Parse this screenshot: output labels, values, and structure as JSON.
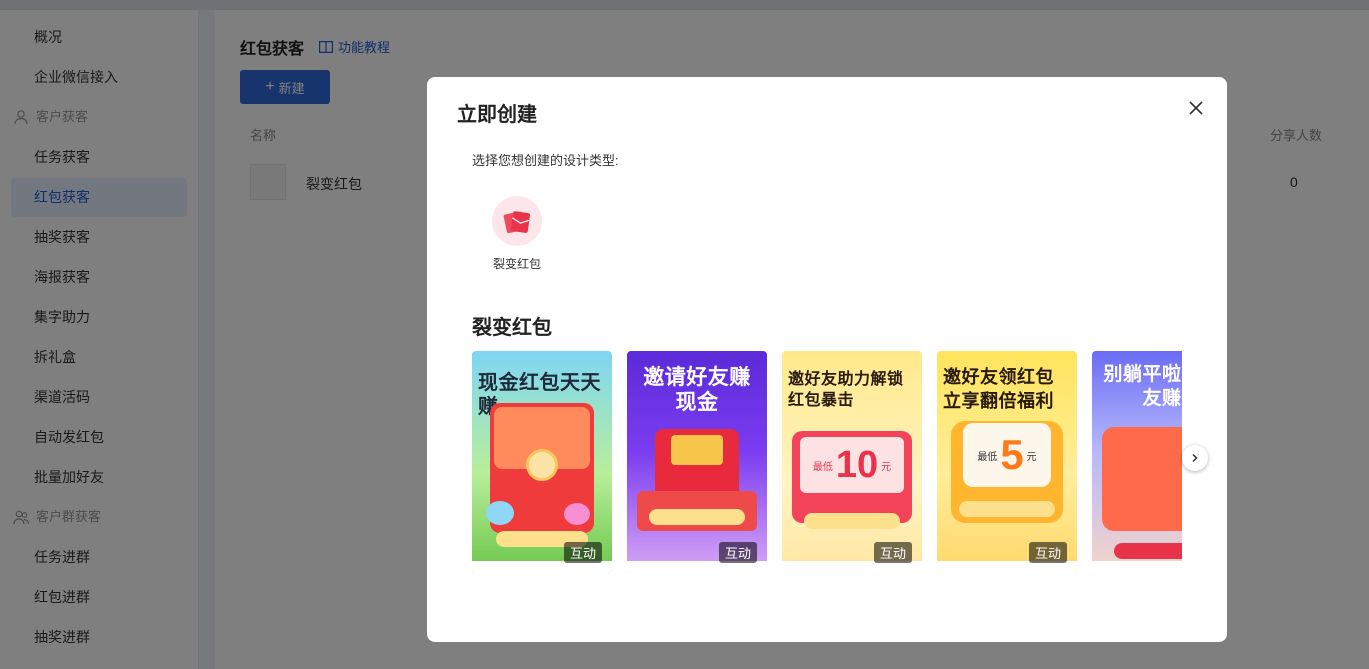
{
  "sidebar": {
    "items": [
      {
        "label": "概况"
      },
      {
        "label": "企业微信接入"
      },
      {
        "label": "客户获客",
        "group": true
      },
      {
        "label": "任务获客"
      },
      {
        "label": "红包获客",
        "active": true
      },
      {
        "label": "抽奖获客"
      },
      {
        "label": "海报获客"
      },
      {
        "label": "集字助力"
      },
      {
        "label": "拆礼盒"
      },
      {
        "label": "渠道活码"
      },
      {
        "label": "自动发红包"
      },
      {
        "label": "批量加好友"
      },
      {
        "label": "客户群获客",
        "group": true
      },
      {
        "label": "任务进群"
      },
      {
        "label": "红包进群"
      },
      {
        "label": "抽奖进群"
      }
    ]
  },
  "page": {
    "title": "红包获客",
    "tutorial_label": "功能教程",
    "new_button": "新建",
    "table": {
      "columns": {
        "name": "名称",
        "share_count": "分享人数"
      },
      "rows": [
        {
          "name": "裂变红包",
          "share_count": "0"
        }
      ]
    }
  },
  "modal": {
    "title": "立即创建",
    "prompt": "选择您想创建的设计类型:",
    "type_label": "裂变红包",
    "section_title": "裂变红包",
    "templates": [
      {
        "title": "现金红包天天赚",
        "tag": "互动"
      },
      {
        "title": "邀请好友赚现金",
        "tag": "互动"
      },
      {
        "title": "邀好友助力解锁红包暴击",
        "tag": "互动",
        "amount": "10",
        "unit": "元",
        "prefix": "最低"
      },
      {
        "title": "邀好友领红包立享翻倍福利",
        "tag": "互动",
        "amount": "5",
        "unit": "元",
        "prefix": "最低"
      },
      {
        "title": "别躺平啦拉好友赚"
      }
    ]
  },
  "colors": {
    "accent": "#2f6bd9",
    "active_bg": "#e6efff",
    "red": "#e8334a"
  }
}
